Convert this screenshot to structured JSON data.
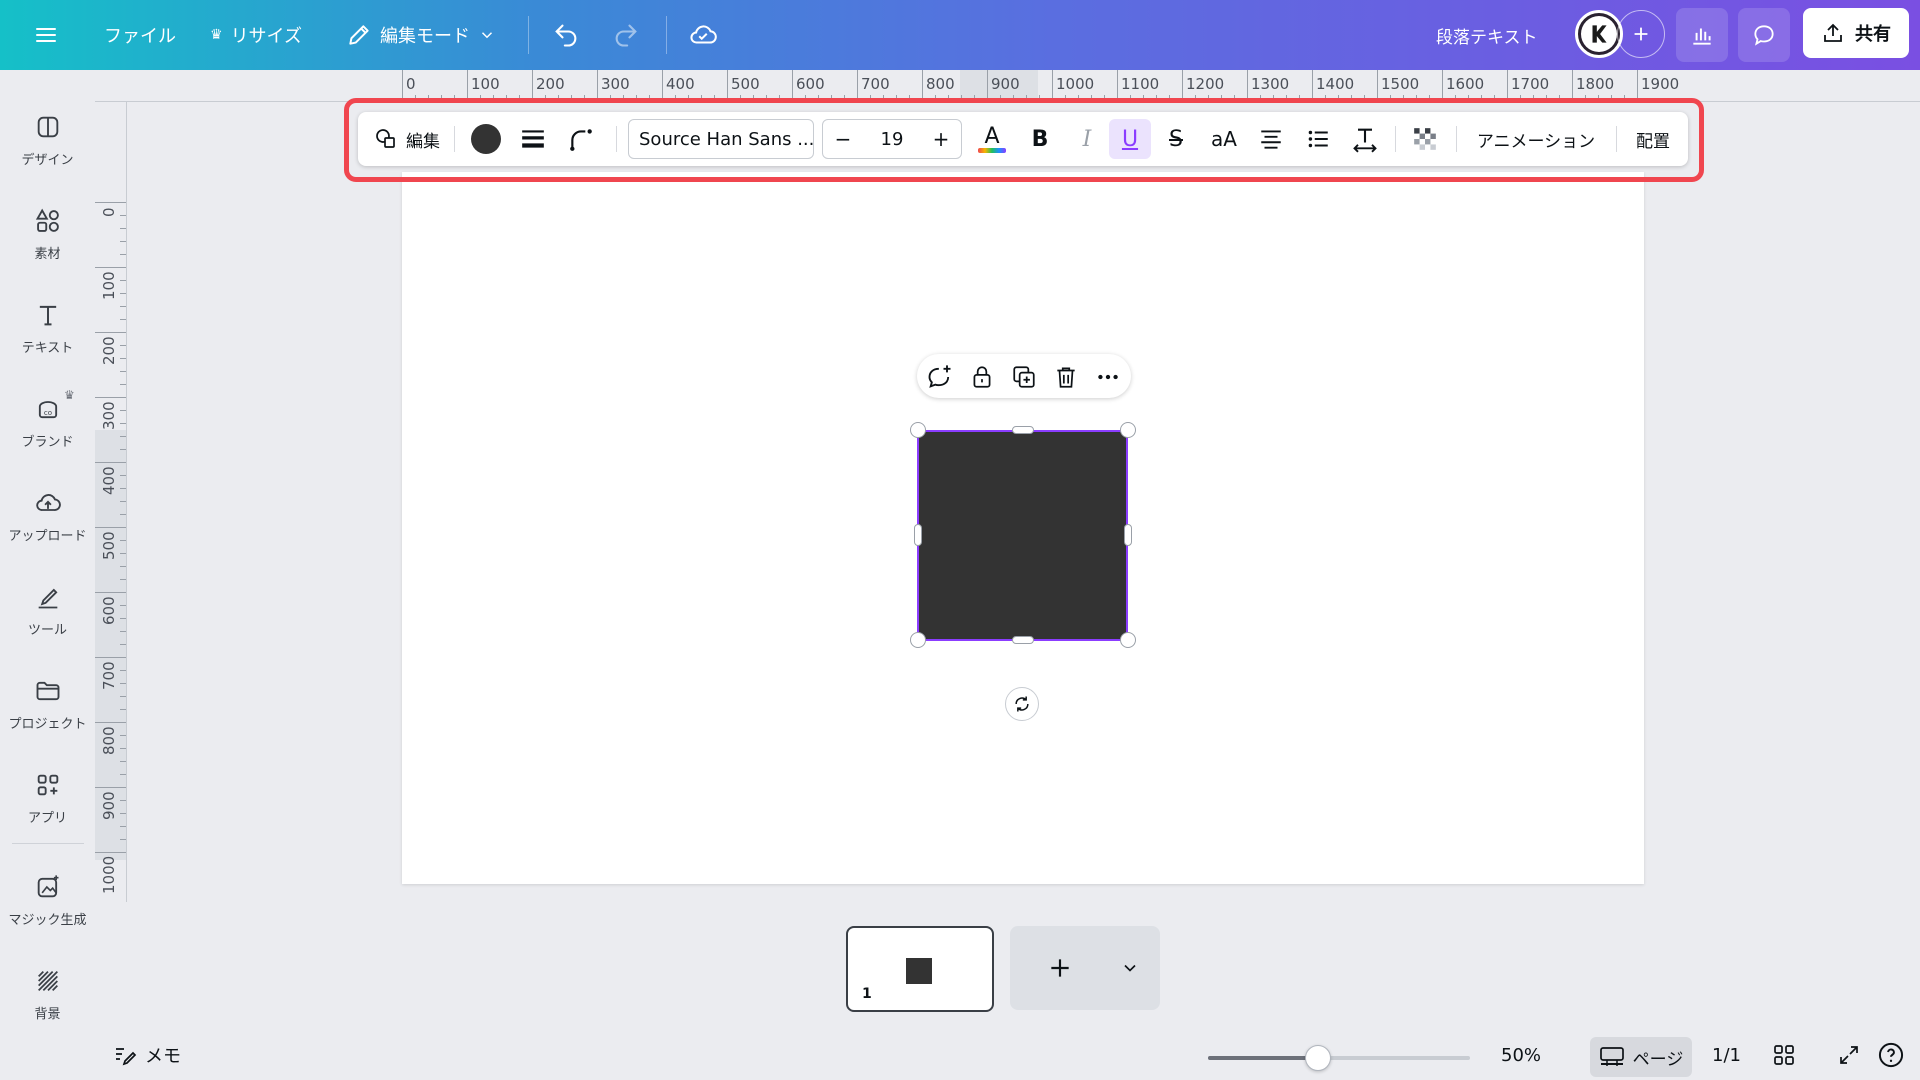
{
  "topbar": {
    "file_label": "ファイル",
    "resize_label": "リサイズ",
    "edit_mode_label": "編集モード",
    "element_type_label": "段落テキスト",
    "share_label": "共有"
  },
  "sidebar": {
    "items": [
      {
        "label": "デザイン",
        "icon": "layout-icon"
      },
      {
        "label": "素材",
        "icon": "elements-icon"
      },
      {
        "label": "テキスト",
        "icon": "text-icon"
      },
      {
        "label": "ブランド",
        "icon": "brand-icon"
      },
      {
        "label": "アップロード",
        "icon": "upload-cloud-icon"
      },
      {
        "label": "ツール",
        "icon": "draw-tool-icon"
      },
      {
        "label": "プロジェクト",
        "icon": "folder-icon"
      },
      {
        "label": "アプリ",
        "icon": "apps-icon"
      },
      {
        "label": "マジック生成",
        "icon": "magic-media-icon"
      },
      {
        "label": "背景",
        "icon": "background-pattern-icon"
      }
    ]
  },
  "ruler": {
    "top_ticks": [
      "0",
      "100",
      "200",
      "300",
      "400",
      "500",
      "600",
      "700",
      "800",
      "900",
      "1000",
      "1100",
      "1200",
      "1300",
      "1400",
      "1500",
      "1600",
      "1700",
      "1800",
      "1900"
    ],
    "left_ticks": [
      "0",
      "100",
      "200",
      "300",
      "400",
      "500",
      "600",
      "700",
      "800",
      "900",
      "1000"
    ]
  },
  "context_toolbar": {
    "edit_label": "編集",
    "fill_color": "#333333",
    "font_name": "Source Han Sans ...",
    "font_size": "19",
    "decrease_label": "−",
    "increase_label": "+",
    "bold_label": "B",
    "italic_label": "I",
    "underline_label": "U",
    "strike_label": "S",
    "case_label": "aA",
    "animate_label": "アニメーション",
    "position_label": "配置",
    "accent_color": "#8b3dff",
    "highlight_color": "#f0464f"
  },
  "page_strip": {
    "page_number": "1",
    "add_label": "+"
  },
  "bottombar": {
    "notes_label": "メモ",
    "zoom_label": "50%",
    "zoom_fraction": 0.42,
    "pages_label": "ページ",
    "page_count": "1/1"
  }
}
